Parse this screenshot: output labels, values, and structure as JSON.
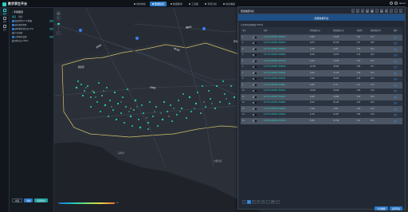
{
  "app": {
    "title": "数字孪生平台"
  },
  "topnav": [
    {
      "label": "城市体检",
      "active": false
    },
    {
      "label": "数据检索",
      "active": true
    },
    {
      "label": "数据服务",
      "active": false
    },
    {
      "label": "工具箱",
      "active": false
    },
    {
      "label": "专项分析",
      "active": false
    },
    {
      "label": "综合看板",
      "active": false
    }
  ],
  "topright": {
    "user": "admin"
  },
  "rail": [
    {
      "label": "图层",
      "active": true
    },
    {
      "label": "检索",
      "active": false
    },
    {
      "label": "统计",
      "active": false
    }
  ],
  "left_panel": {
    "title": "专题图层",
    "tabs": [
      "图层",
      "数据"
    ],
    "items": [
      {
        "label": "建设用地 (1-3) 数据",
        "checked": true,
        "action": "编辑"
      },
      {
        "label": "城市更新项目",
        "checked": true,
        "action": ""
      },
      {
        "label": "建筑物普查信息 (2.0)",
        "checked": true,
        "action": "编辑"
      },
      {
        "label": "产业园区",
        "checked": false,
        "action": ""
      },
      {
        "label": "公共服务设施",
        "checked": true,
        "action": "编辑"
      },
      {
        "label": "地铁站点 500m",
        "checked": false,
        "action": ""
      }
    ],
    "buttons": {
      "reset": "重置",
      "query": "查询",
      "export": "结果导出"
    }
  },
  "map": {
    "labels": [
      "龙华区",
      "南山区",
      "福田区",
      "罗湖区",
      "盐田区",
      "龙岗区",
      "深圳湾",
      "大鹏新区"
    ],
    "legend": {
      "low": "0",
      "high": "100"
    }
  },
  "dialog": {
    "title": "要素数据列表",
    "subtitle": "结果数据列表",
    "info": "共查询到结果数据 1368 条",
    "columns": [
      "序号",
      "",
      "名称",
      "用地面积(㎡)",
      "建筑面积(㎡)",
      "容积率",
      "建筑密度(%)",
      "操作"
    ],
    "rows": [
      [
        "1",
        "CUYXN 1234567-0105A01",
        "3,562",
        "12,538",
        "3.52",
        "41.3",
        "定位"
      ],
      [
        "2",
        "CUYXN 1234567-0105A02",
        "6,874",
        "20,416",
        "2.97",
        "38.6",
        "定位"
      ],
      [
        "3",
        "CUYXN 1234567-0106B01",
        "2,105",
        "8,233",
        "3.91",
        "45.2",
        "定位"
      ],
      [
        "4",
        "CUYXN 1234567-0106B03",
        "9,330",
        "31,872",
        "3.42",
        "36.9",
        "定位"
      ],
      [
        "5",
        "CUYXN 1234567-0107C02",
        "4,418",
        "11,045",
        "2.50",
        "33.1",
        "定位"
      ],
      [
        "6",
        "CUYXN 1234567-0108A05",
        "12,760",
        "46,902",
        "3.68",
        "40.7",
        "定位"
      ],
      [
        "7",
        "CUYXN 1234567-0109D01",
        "5,229",
        "15,146",
        "2.90",
        "35.4",
        "定位"
      ],
      [
        "8",
        "CUYXN 1234567-0110A02",
        "7,951",
        "28,603",
        "3.60",
        "42.8",
        "定位"
      ],
      [
        "9",
        "CUYXN 1234567-0111B04",
        "3,087",
        "9,771",
        "3.17",
        "37.5",
        "定位"
      ],
      [
        "10",
        "CUYXN 1234567-0112C01",
        "10,642",
        "39,208",
        "3.68",
        "44.0",
        "定位"
      ],
      [
        "11",
        "CUYXN 1234567-0113A03",
        "4,906",
        "13,880",
        "2.83",
        "31.6",
        "定位"
      ],
      [
        "12",
        "CUYXN 1234567-0114B02",
        "8,315",
        "30,115",
        "3.62",
        "39.9",
        "定位"
      ],
      [
        "13",
        "CUYXN 1234567-0115D04",
        "2,748",
        "7,962",
        "2.90",
        "34.2",
        "定位"
      ],
      [
        "14",
        "CUYXN 1234567-0116A01",
        "6,103",
        "22,457",
        "3.68",
        "43.5",
        "定位"
      ],
      [
        "15",
        "CUYXN 1234567-0117C03",
        "5,582",
        "16,790",
        "3.01",
        "36.3",
        "定位"
      ]
    ],
    "pager": {
      "prev": "<",
      "pages": [
        "1",
        "2",
        "3",
        "4",
        "...",
        "92"
      ],
      "current": "1",
      "next": ">"
    },
    "actions": {
      "export": "导出数据",
      "close": "关闭列表"
    }
  },
  "colors": {
    "accent": "#2ad2c9",
    "primary": "#2a79c9",
    "bg": "#1b1f26"
  }
}
